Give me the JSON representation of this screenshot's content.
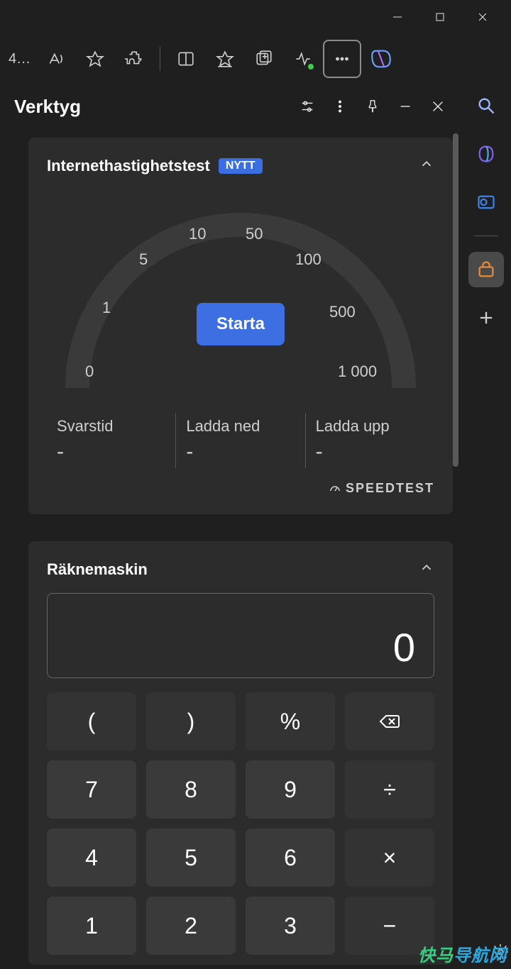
{
  "titlebar": {
    "buttons": [
      "minimize",
      "maximize",
      "close"
    ]
  },
  "toolbar": {
    "tab_label": "4…"
  },
  "sidebar": {
    "items": [
      {
        "name": "copilot"
      },
      {
        "name": "microsoft365"
      },
      {
        "name": "outlook"
      },
      {
        "name": "tools",
        "active": true
      },
      {
        "name": "add"
      }
    ]
  },
  "panel": {
    "title": "Verktyg",
    "header_buttons": [
      "settings",
      "more",
      "pin",
      "minimize",
      "close"
    ]
  },
  "speedtest": {
    "title": "Internethastighetstest",
    "badge": "NYTT",
    "start_label": "Starta",
    "ticks": [
      "0",
      "1",
      "5",
      "10",
      "50",
      "100",
      "500",
      "1 000"
    ],
    "metrics": [
      {
        "label": "Svarstid",
        "value": "-"
      },
      {
        "label": "Ladda ned",
        "value": "-"
      },
      {
        "label": "Ladda upp",
        "value": "-"
      }
    ],
    "provider": "SPEEDTEST"
  },
  "calculator": {
    "title": "Räknemaskin",
    "display": "0",
    "keys": [
      "(",
      ")",
      "%",
      "⌫",
      "7",
      "8",
      "9",
      "÷",
      "4",
      "5",
      "6",
      "×",
      "1",
      "2",
      "3",
      "−"
    ]
  },
  "watermark": "快马导航网"
}
